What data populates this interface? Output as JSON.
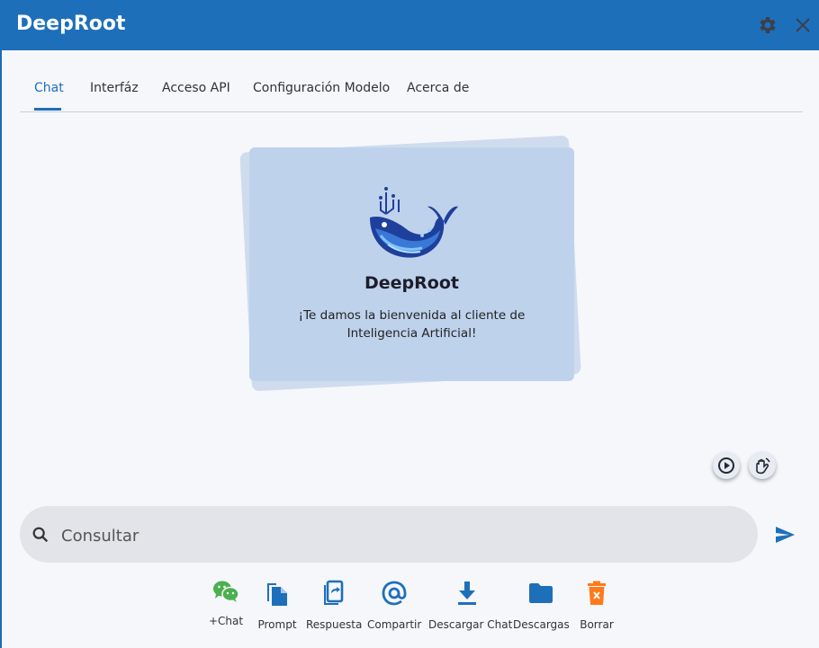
{
  "app": {
    "title": "DeepRoot"
  },
  "tabs": [
    {
      "label": "Chat"
    },
    {
      "label": "Interfáz"
    },
    {
      "label": "Acceso API"
    },
    {
      "label": "Configuración Modelo"
    },
    {
      "label": "Acerca de"
    }
  ],
  "welcome": {
    "title": "DeepRoot",
    "subtitle": "¡Te damos la bienvenida al cliente de Inteligencia Artificial!"
  },
  "search": {
    "placeholder": "Consultar"
  },
  "actions": [
    {
      "label": "+Chat",
      "icon": "wechat-icon"
    },
    {
      "label": "Prompt",
      "icon": "copy-icon"
    },
    {
      "label": "Respuesta",
      "icon": "share-copy-icon"
    },
    {
      "label": "Compartir",
      "icon": "at-icon"
    },
    {
      "label": "Descargar Chat",
      "icon": "download-icon"
    },
    {
      "label": "Descargas",
      "icon": "folder-icon"
    },
    {
      "label": "Borrar",
      "icon": "delete-icon"
    }
  ],
  "colors": {
    "primary": "#1e6fba",
    "green": "#4caf50",
    "orange": "#ff7a1a",
    "card": "#bfd2ec"
  }
}
